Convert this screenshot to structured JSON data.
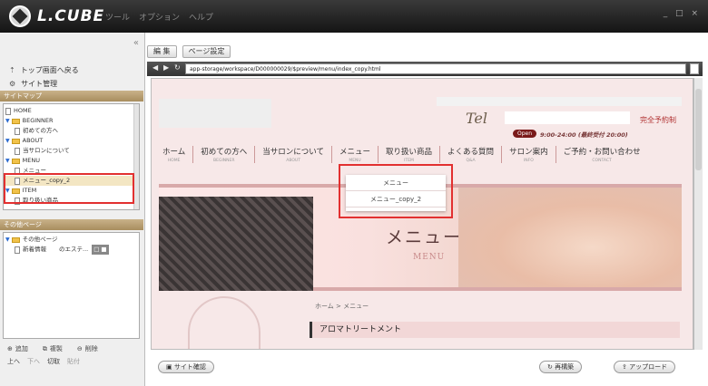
{
  "app": {
    "logo_text": "L.CUBE",
    "menu": [
      "ツール",
      "オプション",
      "ヘルプ"
    ],
    "window_controls": "_ □ ×"
  },
  "left": {
    "collapse": "«",
    "back_label": "トップ画面へ戻る",
    "site_admin_label": "サイト管理",
    "sitemap_label": "サイトマップ",
    "tree": [
      {
        "label": "HOME",
        "type": "page",
        "indent": 0
      },
      {
        "label": "BEGINNER",
        "type": "folder",
        "indent": 0
      },
      {
        "label": "初めての方へ",
        "type": "page",
        "indent": 1
      },
      {
        "label": "ABOUT",
        "type": "folder",
        "indent": 0
      },
      {
        "label": "当サロンについて",
        "type": "page",
        "indent": 1
      },
      {
        "label": "MENU",
        "type": "folder",
        "indent": 0
      },
      {
        "label": "メニュー",
        "type": "page",
        "indent": 1
      },
      {
        "label": "メニュー_copy_2",
        "type": "page",
        "indent": 1,
        "selected": true
      },
      {
        "label": "ITEM",
        "type": "folder",
        "indent": 0
      },
      {
        "label": "取り扱い商品",
        "type": "page",
        "indent": 1
      }
    ],
    "other_label": "その他ページ",
    "other_tree": [
      {
        "label": "その他ページ",
        "type": "folder"
      },
      {
        "label": "新着情報",
        "extra": "のエステ...",
        "badge": "□ ■"
      }
    ],
    "bottom_row1": [
      "追加",
      "複製",
      "削除"
    ],
    "bottom_row2": [
      "上へ",
      "下へ",
      "切取",
      "貼付"
    ]
  },
  "toolbar": {
    "edit_label": "編 集",
    "page_settings_label": "ページ設定"
  },
  "address": {
    "url": "app-storage/workspace/D000000029/$preview/menu/index_copy.html"
  },
  "preview": {
    "tel": "Tel",
    "open_badge": "Open",
    "hours": "9:00-24:00 (最終受付 20:00)",
    "reservation": "完全予約制",
    "nav": [
      {
        "ja": "ホーム",
        "en": "HOME"
      },
      {
        "ja": "初めての方へ",
        "en": "BEGINNER"
      },
      {
        "ja": "当サロンについて",
        "en": "ABOUT"
      },
      {
        "ja": "メニュー",
        "en": "MENU"
      },
      {
        "ja": "取り扱い商品",
        "en": "ITEM"
      },
      {
        "ja": "よくある質問",
        "en": "Q&A"
      },
      {
        "ja": "サロン案内",
        "en": "INFO"
      },
      {
        "ja": "ご予約・お問い合わせ",
        "en": "CONTACT"
      }
    ],
    "dropdown": [
      "メニュー",
      "メニュー_copy_2"
    ],
    "hero_title": "メニュー",
    "hero_sub": "MENU",
    "breadcrumb": "ホーム > メニュー",
    "section_title": "アロマトリートメント"
  },
  "footer": {
    "site_check": "サイト確認",
    "rebuild": "再構築",
    "upload": "アップロード"
  }
}
